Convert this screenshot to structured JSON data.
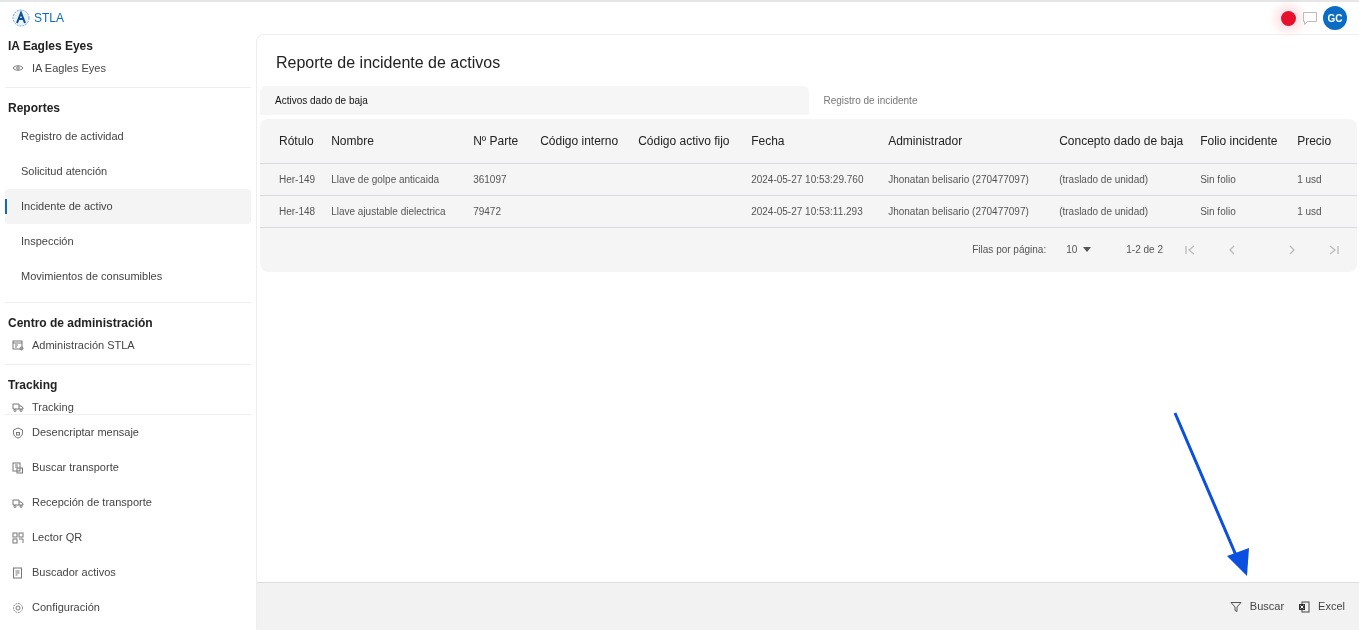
{
  "header": {
    "brand": "STLA",
    "avatar": "GC"
  },
  "sidebar": {
    "sections": [
      {
        "title": "IA Eagles Eyes",
        "items": [
          {
            "label": "IA Eagles Eyes",
            "selected": false
          }
        ]
      },
      {
        "title": "Reportes",
        "items": [
          {
            "label": "Registro de actividad",
            "selected": false
          },
          {
            "label": "Solicitud atención",
            "selected": false
          },
          {
            "label": "Incidente de activo",
            "selected": true
          },
          {
            "label": "Inspección",
            "selected": false
          },
          {
            "label": "Movimientos de consumibles",
            "selected": false
          }
        ]
      },
      {
        "title": "Centro de administración",
        "items": [
          {
            "label": "Administración STLA",
            "selected": false
          }
        ]
      },
      {
        "title": "Tracking",
        "items": [
          {
            "label": "Tracking",
            "selected": false
          }
        ]
      }
    ],
    "bottom_items": [
      {
        "label": "Desencriptar mensaje",
        "selected": false
      },
      {
        "label": "Buscar transporte",
        "selected": false
      },
      {
        "label": "Recepción de transporte",
        "selected": false
      },
      {
        "label": "Lector QR",
        "selected": false
      },
      {
        "label": "Buscador activos",
        "selected": false
      },
      {
        "label": "Configuración",
        "selected": false
      }
    ]
  },
  "page": {
    "title": "Reporte de incidente de activos",
    "tabs": [
      {
        "label": "Activos dado de baja",
        "selected": true
      },
      {
        "label": "Registro de incidente",
        "selected": false
      }
    ],
    "table": {
      "columns": [
        "Rótulo",
        "Nombre",
        "Nº Parte",
        "Código interno",
        "Código activo fijo",
        "Fecha",
        "Administrador",
        "Concepto dado de baja",
        "Folio incidente",
        "Precio"
      ],
      "rows": [
        [
          "Her-149",
          "Llave de golpe anticaida",
          "361097",
          "",
          "",
          "2024-05-27 10:53:29.760",
          "Jhonatan belisario  (270477097)",
          "(traslado de unidad)",
          "Sin folio",
          "1 usd"
        ],
        [
          "Her-148",
          "Llave ajustable dielectrica",
          "79472",
          "",
          "",
          "2024-05-27 10:53:11.293",
          "Jhonatan belisario  (270477097)",
          "(traslado de unidad)",
          "Sin folio",
          "1 usd"
        ]
      ]
    },
    "pagination": {
      "rows_label": "Filas por página:",
      "rows_per_page": "10",
      "range": "1-2 de 2",
      "first_disabled": true,
      "prev_disabled": true,
      "next_disabled": true,
      "last_disabled": true
    }
  },
  "footer": {
    "actions": [
      {
        "label": "Buscar"
      },
      {
        "label": "Excel"
      }
    ]
  }
}
